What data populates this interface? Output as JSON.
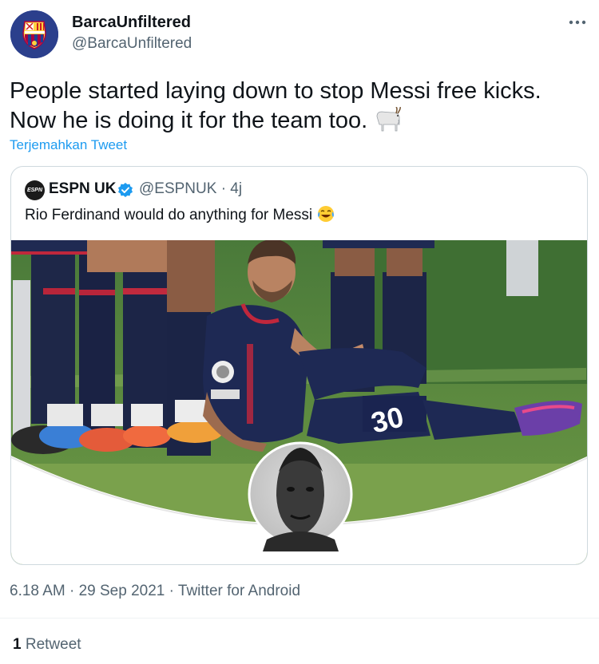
{
  "tweet": {
    "author_name": "BarcaUnfiltered",
    "author_handle": "@BarcaUnfiltered",
    "text_line1": "People started laying down to stop Messi free kicks.",
    "text_line2": "Now he is doing it for the team too.",
    "translate_label": "Terjemahkan Tweet",
    "timestamp": "6.18 AM · 29 Sep 2021 · Twitter for Android",
    "retweet_count": "1",
    "retweet_label": "Retweet",
    "more_icon": "more-horizontal-icon",
    "emoji_icon": "goat-emoji"
  },
  "quoted": {
    "avatar_text": "ESPN",
    "author_name": "ESPN UK",
    "author_handle": "@ESPNUK · 4j",
    "text": "Rio Ferdinand would do anything for Messi",
    "emoji_icon": "tears-of-joy-emoji",
    "verified_icon": "verified-badge-icon",
    "image_jersey_number": "30",
    "image_description_icon": "photo-messi-lying-behind-wall"
  },
  "colors": {
    "link": "#1d9bf0",
    "secondary_text": "#536471",
    "primary_text": "#0f1419",
    "border": "#cfd9de"
  }
}
